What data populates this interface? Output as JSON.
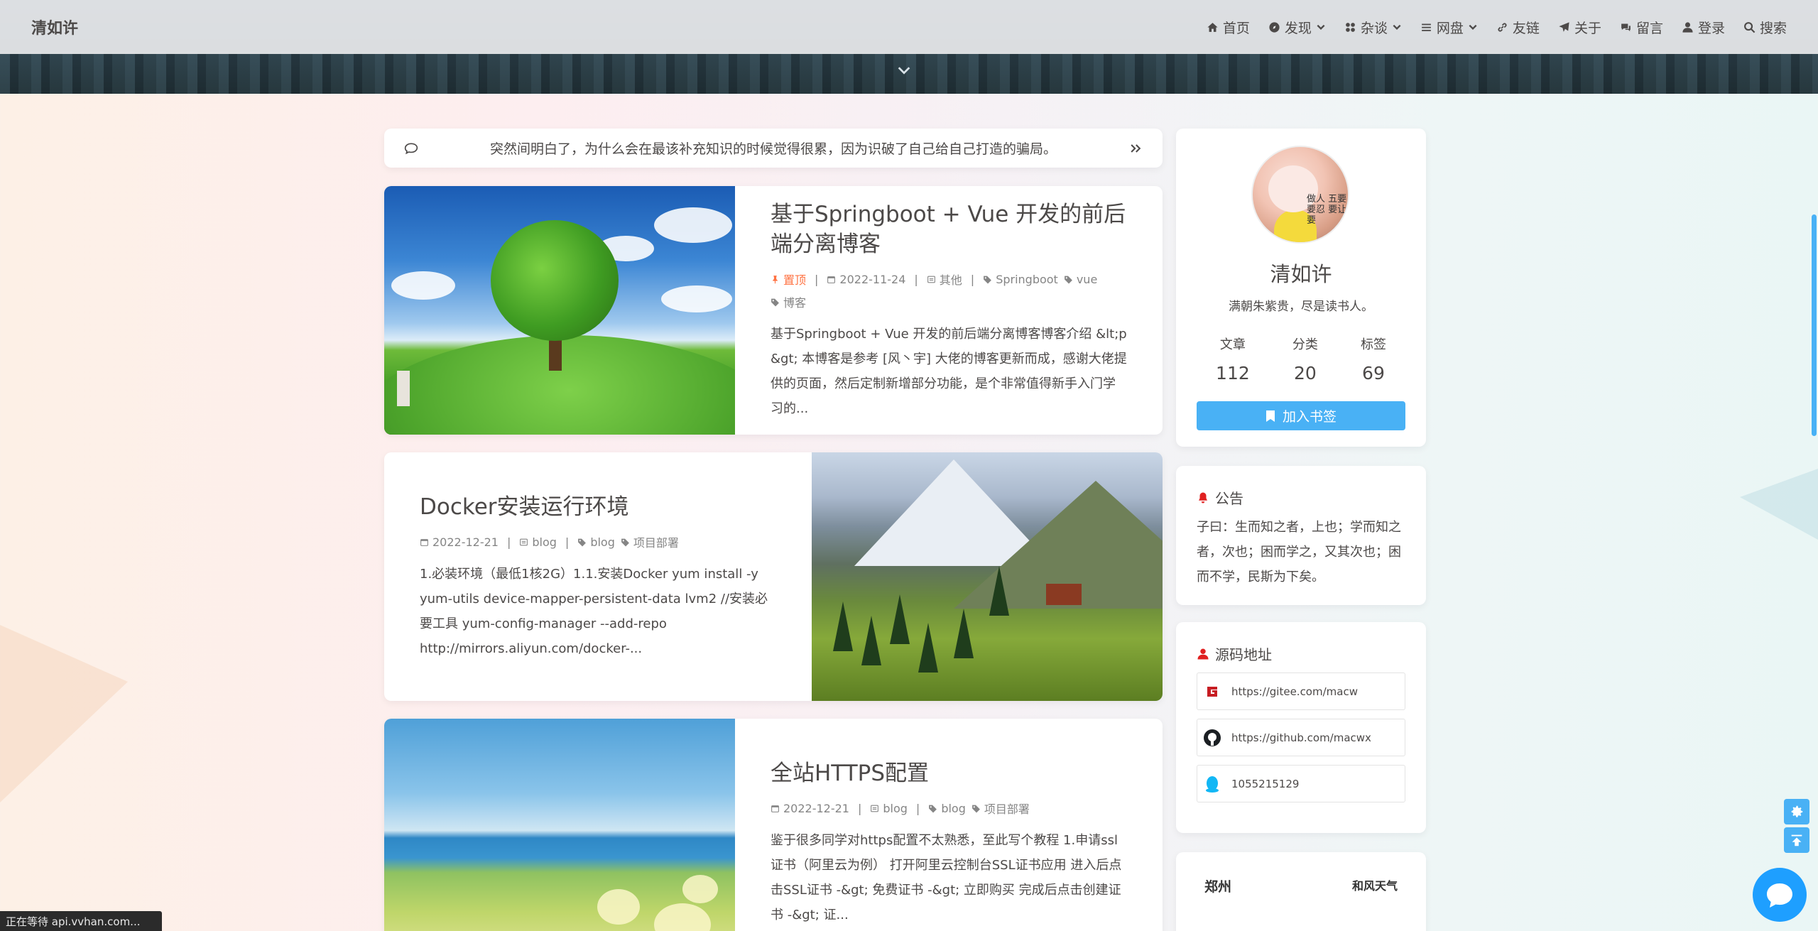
{
  "nav": {
    "site_title": "清如许",
    "items": [
      {
        "label": "首页",
        "icon": "home-icon",
        "caret": false
      },
      {
        "label": "发现",
        "icon": "compass-icon",
        "caret": true
      },
      {
        "label": "杂谈",
        "icon": "grid-icon",
        "caret": true
      },
      {
        "label": "网盘",
        "icon": "list-icon",
        "caret": true
      },
      {
        "label": "友链",
        "icon": "link-icon",
        "caret": false
      },
      {
        "label": "关于",
        "icon": "paper-plane-icon",
        "caret": false
      },
      {
        "label": "留言",
        "icon": "comments-icon",
        "caret": false
      },
      {
        "label": "登录",
        "icon": "user-icon",
        "caret": false
      },
      {
        "label": "搜索",
        "icon": "search-icon",
        "caret": false
      }
    ]
  },
  "notice": {
    "text": "突然间明白了，为什么会在最该补充知识的时候觉得很累，因为识破了自己给自己打造的骗局。"
  },
  "posts": [
    {
      "title": "基于Springboot + Vue 开发的前后端分离博客",
      "sticky": "置顶",
      "date": "2022-11-24",
      "category": "其他",
      "tags": [
        "Springboot",
        "vue",
        "博客"
      ],
      "excerpt": "基于Springboot + Vue 开发的前后端分离博客博客介绍 &lt;p &gt; 本博客是参考 [风丶宇] 大佬的博客更新而成，感谢大佬提供的页面，然后定制新增部分功能，是个非常值得新手入门学习的..."
    },
    {
      "title": "Docker安装运行环境",
      "sticky": "",
      "date": "2022-12-21",
      "category": "blog",
      "tags": [
        "blog",
        "项目部署"
      ],
      "excerpt": "1.必装环境（最低1核2G）1.1.安装Docker yum install -y yum-utils device-mapper-persistent-data lvm2 //安装必要工具 yum-config-manager --add-repo http://mirrors.aliyun.com/docker-..."
    },
    {
      "title": "全站HTTPS配置",
      "sticky": "",
      "date": "2022-12-21",
      "category": "blog",
      "tags": [
        "blog",
        "项目部署"
      ],
      "excerpt": "鉴于很多同学对https配置不太熟悉，至此写个教程 1.申请ssl证书（阿里云为例） 打开阿里云控制台SSL证书应用 进入后点击SSL证书 -&gt; 免费证书 -&gt; 立即购买 完成后点击创建证书 -&gt; 证..."
    }
  ],
  "profile": {
    "avatar_text": "做人 五要 要忍 要让 要",
    "name": "清如许",
    "description": "满朝朱紫贵，尽是读书人。",
    "stats": [
      {
        "label": "文章",
        "value": "112"
      },
      {
        "label": "分类",
        "value": "20"
      },
      {
        "label": "标签",
        "value": "69"
      }
    ],
    "bookmark_label": "加入书签"
  },
  "announcement": {
    "title": "公告",
    "text": "子曰：生而知之者，上也；学而知之者，次也；困而学之，又其次也；困而不学，民斯为下矣。"
  },
  "source": {
    "title": "源码地址",
    "links": [
      {
        "text": "https://gitee.com/macw",
        "icon": "gitee-icon"
      },
      {
        "text": "https://github.com/macwx",
        "icon": "github-icon"
      },
      {
        "text": "1055215129",
        "icon": "qq-icon"
      }
    ]
  },
  "weather": {
    "city": "郑州",
    "brand": "和风天气"
  },
  "status_bar": {
    "text": "正在等待 api.vvhan.com..."
  },
  "colors": {
    "accent": "#49b1f5",
    "sticky": "#ff7242",
    "text": "#4c4948",
    "meta": "#858585",
    "chat": "#1e9fff"
  }
}
